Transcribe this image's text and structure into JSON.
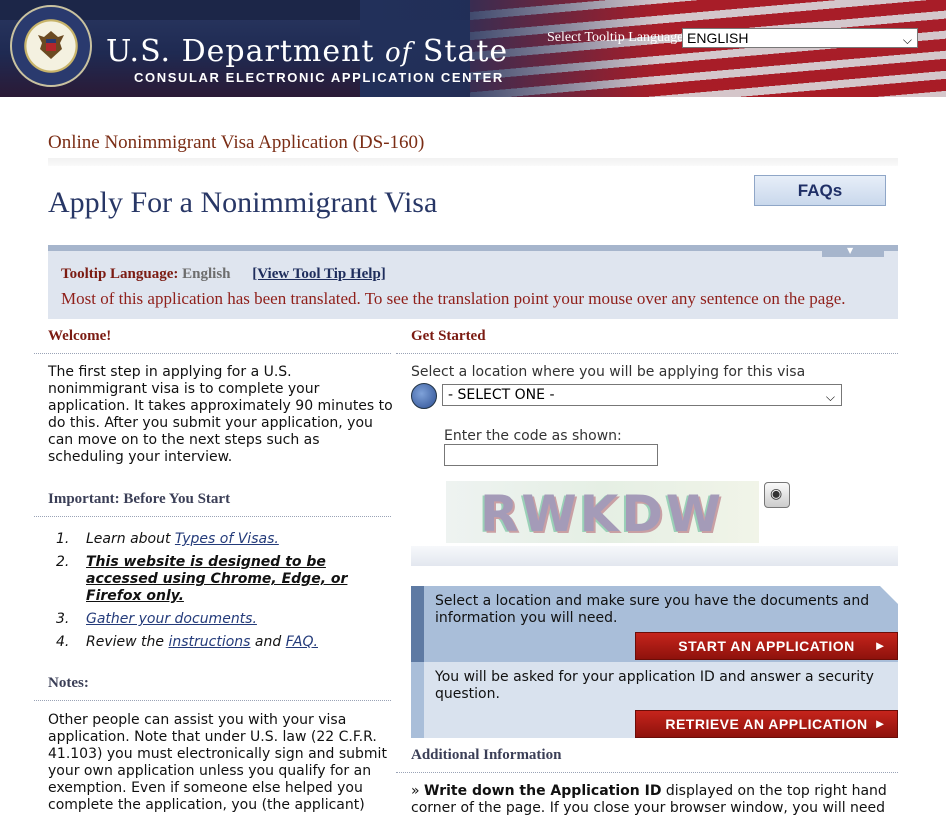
{
  "header": {
    "dept_name_prefix": "U.S. Department ",
    "dept_name_of": "of",
    "dept_name_suffix": " State",
    "subtitle": "CONSULAR ELECTRONIC APPLICATION CENTER",
    "tooltip_language_label": "Select Tooltip Language",
    "tooltip_language_value": "ENGLISH",
    "seal_icon": "department-of-state-seal"
  },
  "page": {
    "app_title": "Online Nonimmigrant Visa Application (DS-160)",
    "title": "Apply For a Nonimmigrant Visa",
    "faqs_label": "FAQs"
  },
  "tooltip_box": {
    "label": "Tooltip Language:",
    "value": "English",
    "help_link": "[View Tool Tip Help]",
    "message": "Most of this application has been translated. To see the translation point your mouse over any sentence on the page."
  },
  "welcome": {
    "heading": "Welcome!",
    "text": "The first step in applying for a U.S. nonimmigrant visa is to complete your application. It takes approximately 90 minutes to do this. After you submit your application, you can move on to the next steps such as scheduling your interview."
  },
  "important": {
    "heading": "Important: Before You Start",
    "steps": [
      {
        "num": "1.",
        "prefix": "Learn about ",
        "link": "Types of Visas."
      },
      {
        "num": "2.",
        "bold": "This website is designed to be accessed using Chrome, Edge, or Firefox only."
      },
      {
        "num": "3.",
        "link": "Gather your documents."
      },
      {
        "num": "4.",
        "prefix": "Review the ",
        "link": "instructions",
        "middle": " and ",
        "link2": "FAQ."
      }
    ]
  },
  "notes": {
    "heading": "Notes:",
    "text": "Other people can assist you with your visa application. Note that under U.S. law (22 C.F.R. 41.103) you must electronically sign and submit your own application unless you qualify for an exemption. Even if someone else helped you complete the application, you (the applicant)"
  },
  "get_started": {
    "heading": "Get Started",
    "location_label": "Select a location where you will be applying for this visa",
    "location_value": "- SELECT ONE -",
    "code_label": "Enter the code as shown:",
    "code_value": "",
    "captcha_text": "RWKDW"
  },
  "panels": {
    "start_text": "Select a location and make sure you have the documents and information you will need.",
    "start_button": "START AN APPLICATION",
    "retrieve_text": "You will be asked for your application ID and answer a security question.",
    "retrieve_button": "RETRIEVE AN APPLICATION"
  },
  "additional": {
    "heading": "Additional Information",
    "bullet": "»",
    "bold": "Write down the Application ID",
    "text": " displayed on the top right hand corner of the page. If you close your browser window, you will need"
  },
  "colors": {
    "brand_navy": "#283766",
    "heading_maroon": "#7b2d15",
    "button_red": "#a8170f"
  }
}
